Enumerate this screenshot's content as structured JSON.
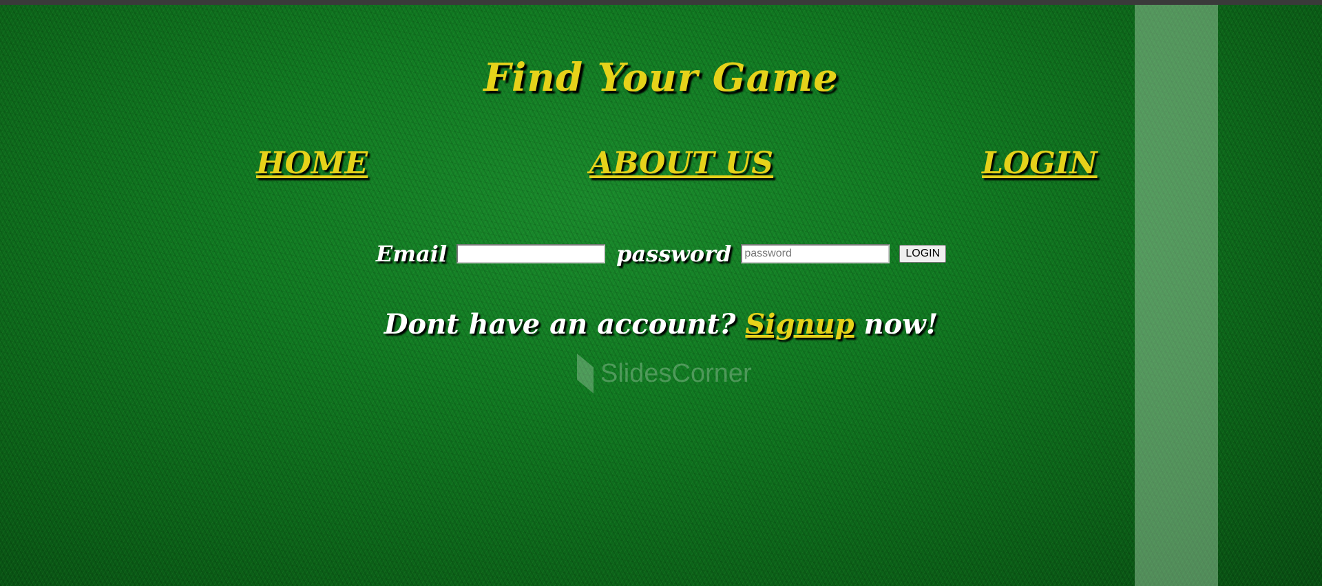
{
  "header": {
    "title": "Find Your Game"
  },
  "nav": {
    "home": "HOME",
    "about": "ABOUT US",
    "login": "LOGIN"
  },
  "login_form": {
    "email_label": "Email",
    "email_value": "",
    "password_label": "password",
    "password_placeholder": "password",
    "submit_label": "LOGIN"
  },
  "signup": {
    "prefix": "Dont have an account?",
    "link": "Signup",
    "suffix": "now!"
  },
  "watermark": {
    "text": "SlidesCorner"
  },
  "colors": {
    "accent": "#e6d21a",
    "grass": "#117a22",
    "field_line": "#aad2af"
  }
}
